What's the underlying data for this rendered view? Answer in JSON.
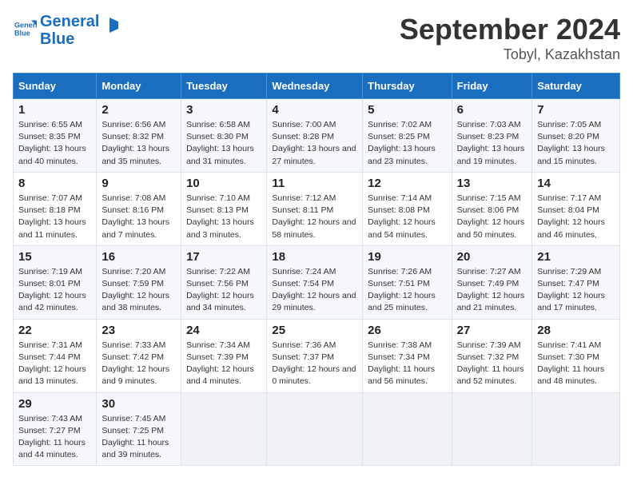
{
  "header": {
    "logo_line1": "General",
    "logo_line2": "Blue",
    "month": "September 2024",
    "location": "Tobyl, Kazakhstan"
  },
  "days_of_week": [
    "Sunday",
    "Monday",
    "Tuesday",
    "Wednesday",
    "Thursday",
    "Friday",
    "Saturday"
  ],
  "weeks": [
    [
      {
        "day": "1",
        "sunrise": "Sunrise: 6:55 AM",
        "sunset": "Sunset: 8:35 PM",
        "daylight": "Daylight: 13 hours and 40 minutes."
      },
      {
        "day": "2",
        "sunrise": "Sunrise: 6:56 AM",
        "sunset": "Sunset: 8:32 PM",
        "daylight": "Daylight: 13 hours and 35 minutes."
      },
      {
        "day": "3",
        "sunrise": "Sunrise: 6:58 AM",
        "sunset": "Sunset: 8:30 PM",
        "daylight": "Daylight: 13 hours and 31 minutes."
      },
      {
        "day": "4",
        "sunrise": "Sunrise: 7:00 AM",
        "sunset": "Sunset: 8:28 PM",
        "daylight": "Daylight: 13 hours and 27 minutes."
      },
      {
        "day": "5",
        "sunrise": "Sunrise: 7:02 AM",
        "sunset": "Sunset: 8:25 PM",
        "daylight": "Daylight: 13 hours and 23 minutes."
      },
      {
        "day": "6",
        "sunrise": "Sunrise: 7:03 AM",
        "sunset": "Sunset: 8:23 PM",
        "daylight": "Daylight: 13 hours and 19 minutes."
      },
      {
        "day": "7",
        "sunrise": "Sunrise: 7:05 AM",
        "sunset": "Sunset: 8:20 PM",
        "daylight": "Daylight: 13 hours and 15 minutes."
      }
    ],
    [
      {
        "day": "8",
        "sunrise": "Sunrise: 7:07 AM",
        "sunset": "Sunset: 8:18 PM",
        "daylight": "Daylight: 13 hours and 11 minutes."
      },
      {
        "day": "9",
        "sunrise": "Sunrise: 7:08 AM",
        "sunset": "Sunset: 8:16 PM",
        "daylight": "Daylight: 13 hours and 7 minutes."
      },
      {
        "day": "10",
        "sunrise": "Sunrise: 7:10 AM",
        "sunset": "Sunset: 8:13 PM",
        "daylight": "Daylight: 13 hours and 3 minutes."
      },
      {
        "day": "11",
        "sunrise": "Sunrise: 7:12 AM",
        "sunset": "Sunset: 8:11 PM",
        "daylight": "Daylight: 12 hours and 58 minutes."
      },
      {
        "day": "12",
        "sunrise": "Sunrise: 7:14 AM",
        "sunset": "Sunset: 8:08 PM",
        "daylight": "Daylight: 12 hours and 54 minutes."
      },
      {
        "day": "13",
        "sunrise": "Sunrise: 7:15 AM",
        "sunset": "Sunset: 8:06 PM",
        "daylight": "Daylight: 12 hours and 50 minutes."
      },
      {
        "day": "14",
        "sunrise": "Sunrise: 7:17 AM",
        "sunset": "Sunset: 8:04 PM",
        "daylight": "Daylight: 12 hours and 46 minutes."
      }
    ],
    [
      {
        "day": "15",
        "sunrise": "Sunrise: 7:19 AM",
        "sunset": "Sunset: 8:01 PM",
        "daylight": "Daylight: 12 hours and 42 minutes."
      },
      {
        "day": "16",
        "sunrise": "Sunrise: 7:20 AM",
        "sunset": "Sunset: 7:59 PM",
        "daylight": "Daylight: 12 hours and 38 minutes."
      },
      {
        "day": "17",
        "sunrise": "Sunrise: 7:22 AM",
        "sunset": "Sunset: 7:56 PM",
        "daylight": "Daylight: 12 hours and 34 minutes."
      },
      {
        "day": "18",
        "sunrise": "Sunrise: 7:24 AM",
        "sunset": "Sunset: 7:54 PM",
        "daylight": "Daylight: 12 hours and 29 minutes."
      },
      {
        "day": "19",
        "sunrise": "Sunrise: 7:26 AM",
        "sunset": "Sunset: 7:51 PM",
        "daylight": "Daylight: 12 hours and 25 minutes."
      },
      {
        "day": "20",
        "sunrise": "Sunrise: 7:27 AM",
        "sunset": "Sunset: 7:49 PM",
        "daylight": "Daylight: 12 hours and 21 minutes."
      },
      {
        "day": "21",
        "sunrise": "Sunrise: 7:29 AM",
        "sunset": "Sunset: 7:47 PM",
        "daylight": "Daylight: 12 hours and 17 minutes."
      }
    ],
    [
      {
        "day": "22",
        "sunrise": "Sunrise: 7:31 AM",
        "sunset": "Sunset: 7:44 PM",
        "daylight": "Daylight: 12 hours and 13 minutes."
      },
      {
        "day": "23",
        "sunrise": "Sunrise: 7:33 AM",
        "sunset": "Sunset: 7:42 PM",
        "daylight": "Daylight: 12 hours and 9 minutes."
      },
      {
        "day": "24",
        "sunrise": "Sunrise: 7:34 AM",
        "sunset": "Sunset: 7:39 PM",
        "daylight": "Daylight: 12 hours and 4 minutes."
      },
      {
        "day": "25",
        "sunrise": "Sunrise: 7:36 AM",
        "sunset": "Sunset: 7:37 PM",
        "daylight": "Daylight: 12 hours and 0 minutes."
      },
      {
        "day": "26",
        "sunrise": "Sunrise: 7:38 AM",
        "sunset": "Sunset: 7:34 PM",
        "daylight": "Daylight: 11 hours and 56 minutes."
      },
      {
        "day": "27",
        "sunrise": "Sunrise: 7:39 AM",
        "sunset": "Sunset: 7:32 PM",
        "daylight": "Daylight: 11 hours and 52 minutes."
      },
      {
        "day": "28",
        "sunrise": "Sunrise: 7:41 AM",
        "sunset": "Sunset: 7:30 PM",
        "daylight": "Daylight: 11 hours and 48 minutes."
      }
    ],
    [
      {
        "day": "29",
        "sunrise": "Sunrise: 7:43 AM",
        "sunset": "Sunset: 7:27 PM",
        "daylight": "Daylight: 11 hours and 44 minutes."
      },
      {
        "day": "30",
        "sunrise": "Sunrise: 7:45 AM",
        "sunset": "Sunset: 7:25 PM",
        "daylight": "Daylight: 11 hours and 39 minutes."
      },
      null,
      null,
      null,
      null,
      null
    ]
  ]
}
